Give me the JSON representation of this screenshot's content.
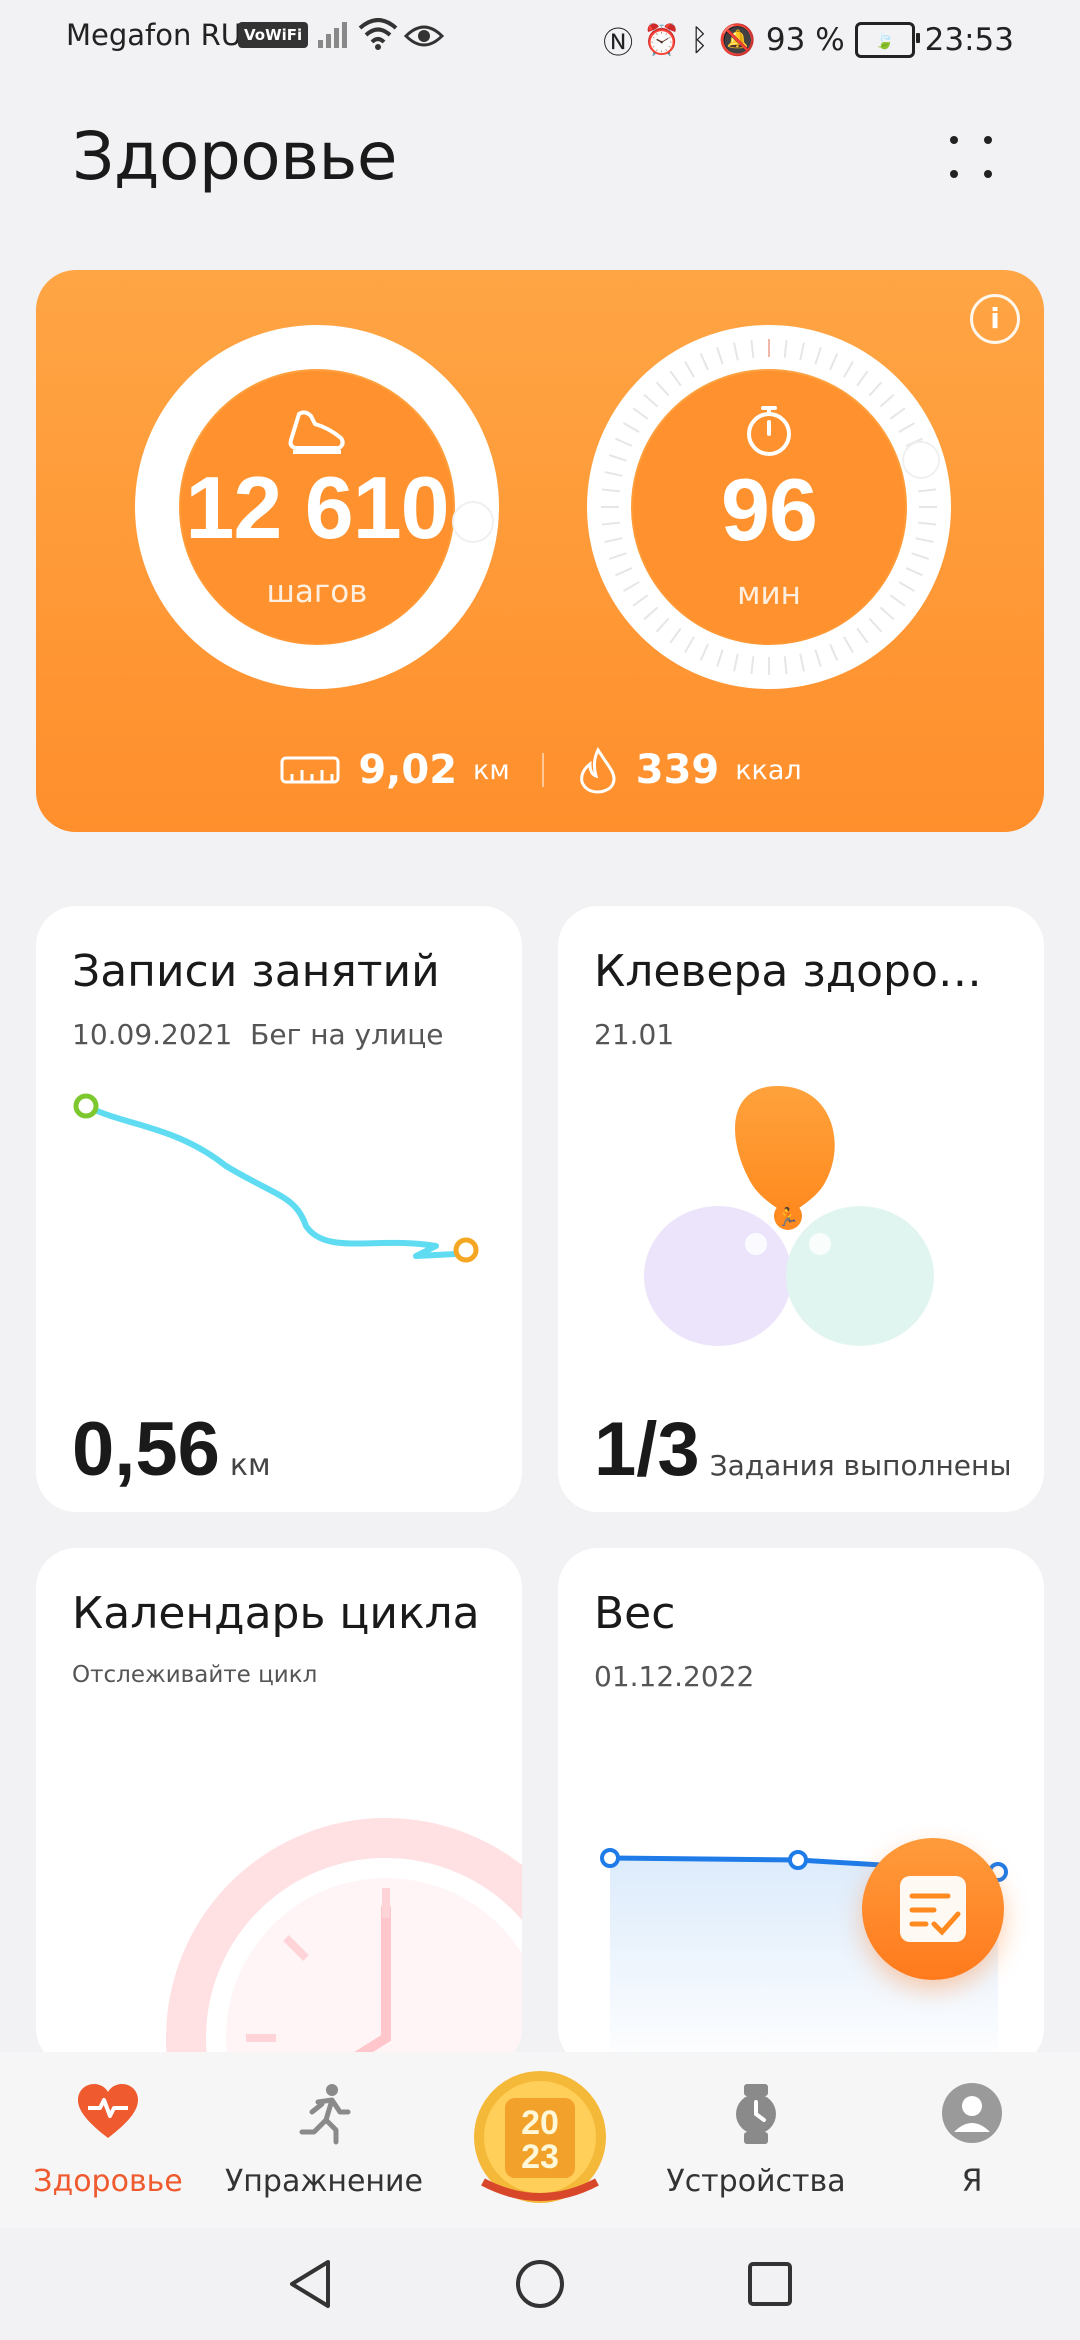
{
  "status_bar": {
    "carrier": "Megafon RUS",
    "vowifi": "VoWiFi",
    "battery": "93 %",
    "time": "23:53"
  },
  "header": {
    "title": "Здоровье"
  },
  "activity": {
    "steps": "12 610",
    "steps_unit": "шагов",
    "minutes": "96",
    "minutes_unit": "мин",
    "distance": "9,02",
    "distance_unit": "км",
    "calories": "339",
    "calories_unit": "ккал"
  },
  "cards": {
    "workout": {
      "title": "Записи занятий",
      "date": "10.09.2021",
      "type": "Бег на улице",
      "value": "0,56",
      "unit": "км"
    },
    "clover": {
      "title": "Клевера здоро…",
      "date": "21.01",
      "value": "1/3",
      "label": "Задания выполнены"
    },
    "cycle": {
      "title": "Календарь цикла",
      "subtitle": "Отслеживайте цикл"
    },
    "weight": {
      "title": "Вес",
      "date": "01.12.2022"
    }
  },
  "nav": {
    "health": "Здоровье",
    "exercise": "Упражнение",
    "devices": "Устройства",
    "me": "Я"
  },
  "colors": {
    "accent": "#ff952f",
    "nav_active": "#ef5a2e",
    "route": "#5fdcf2",
    "weight_line": "#1e7be8"
  }
}
